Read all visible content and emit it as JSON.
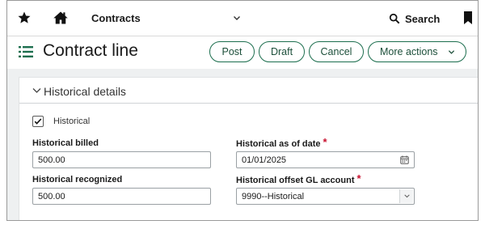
{
  "topnav": {
    "title": "Contracts",
    "search_label": "Search"
  },
  "header": {
    "title": "Contract line",
    "buttons": {
      "post": "Post",
      "draft": "Draft",
      "cancel": "Cancel",
      "more": "More actions"
    }
  },
  "section": {
    "title": "Historical details",
    "checkbox": {
      "label": "Historical",
      "checked": true
    },
    "fields": {
      "historical_billed": {
        "label": "Historical billed",
        "value": "500.00"
      },
      "historical_recognized": {
        "label": "Historical recognized",
        "value": "500.00"
      },
      "historical_as_of_date": {
        "label": "Historical as of date",
        "value": "01/01/2025",
        "required_mark": "*"
      },
      "historical_offset_gl": {
        "label": "Historical offset GL account",
        "value": "9990--Historical",
        "required_mark": "*"
      }
    }
  },
  "colors": {
    "accent": "#1c6e4e",
    "required": "#c8102e",
    "background": "#eef0f1"
  },
  "icons": [
    "star-icon",
    "home-icon",
    "chevron-down-icon",
    "search-icon",
    "bookmark-icon",
    "list-menu-icon",
    "checkmark-icon",
    "calendar-icon"
  ]
}
